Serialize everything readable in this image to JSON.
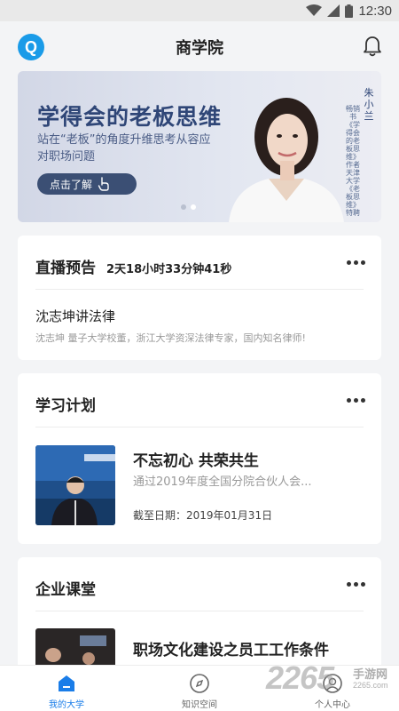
{
  "status": {
    "time": "12:30",
    "icons": [
      "wifi-icon",
      "signal-icon",
      "battery-icon"
    ]
  },
  "header": {
    "title": "商学院",
    "logo_letter": "Q"
  },
  "banner": {
    "headline": "学得会的老板思维",
    "subtitle": "站在“老板”的角度升维思考从容应对职场问题",
    "button_label": "点击了解",
    "name": "朱小兰",
    "description": "畅销书《学得会的老板思维》作者 天津大学《老板思维》特聘讲师",
    "pages": 2,
    "active_page": 1
  },
  "live": {
    "section_title": "直播预告",
    "countdown": "2天18小时33分钟41秒",
    "course_title": "沈志坤讲法律",
    "course_desc": "沈志坤 量子大学校董，浙江大学资深法律专家，国内知名律师!"
  },
  "plan": {
    "section_title": "学习计划",
    "item": {
      "title": "不忘初心 共荣共生",
      "subtitle": "通过2019年度全国分院合伙人会...",
      "deadline": "截至日期：2019年01月31日"
    }
  },
  "enterprise": {
    "section_title": "企业课堂",
    "item": {
      "title": "职场文化建设之员工工作条件"
    }
  },
  "tabs": [
    {
      "label": "我的大学",
      "icon": "home-icon",
      "active": true
    },
    {
      "label": "知识空间",
      "icon": "compass-icon",
      "active": false
    },
    {
      "label": "个人中心",
      "icon": "user-icon",
      "active": false
    }
  ],
  "watermark": {
    "number": "2265",
    "text": "手游网",
    "url": "2265.com"
  },
  "colors": {
    "accent": "#1a7de8",
    "logo": "#1a9be8",
    "banner_text": "#2f4677"
  }
}
